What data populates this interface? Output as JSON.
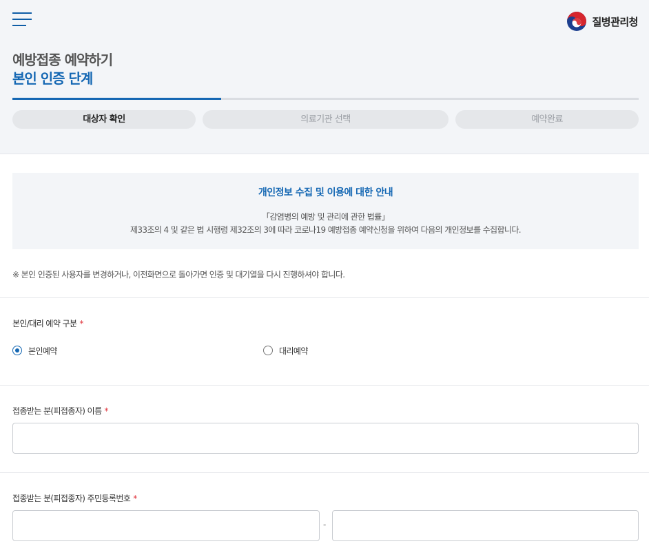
{
  "header": {
    "logo_text": "질병관리청",
    "title_line1": "예방접종 예약하기",
    "title_line2": "본인 인증 단계",
    "progress_fraction": 0.333,
    "steps": [
      {
        "label": "대상자 확인",
        "active": true
      },
      {
        "label": "의료기관 선택",
        "active": false
      },
      {
        "label": "예약완료",
        "active": false
      }
    ]
  },
  "notice": {
    "title": "개인정보 수집 및 이용에 대한 안내",
    "line1": "「감염병의 예방 및 관리에 관한 법률」",
    "line2": "제33조의 4 및 같은 법 시행령 제32조의 3에 따라 코로나19 예방접종 예약신청을 위하여 다음의 개인정보를 수집합니다."
  },
  "warning": "※ 본인 인증된 사용자를 변경하거나, 이전화면으로 돌아가면 인증 및 대기열을 다시 진행하셔야 합니다.",
  "form": {
    "reservation_type_label": "본인/대리 예약 구분",
    "required_mark": "*",
    "options": [
      {
        "label": "본인예약",
        "selected": true
      },
      {
        "label": "대리예약",
        "selected": false
      }
    ],
    "name_label": "접종받는 분(피접종자) 이름",
    "name_value": "",
    "rrn_label": "접종받는 분(피접종자) 주민등록번호",
    "rrn_front_value": "",
    "rrn_back_value": "",
    "rrn_separator": "-"
  },
  "colors": {
    "accent": "#1467b3",
    "required": "#e0343c",
    "header_bg": "#f3f5f8"
  },
  "icons": {
    "menu": "hamburger-menu-icon",
    "logo": "taegeuk-emblem-icon"
  }
}
